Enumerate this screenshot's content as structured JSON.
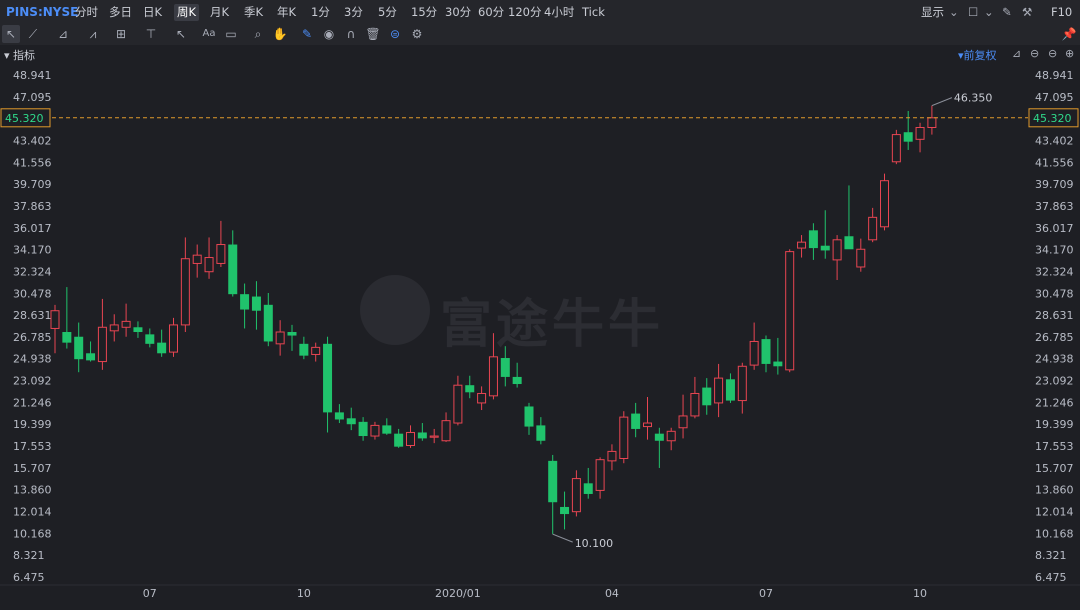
{
  "symbol": "PINS:NYSE",
  "periods": [
    "分时",
    "多日",
    "日K",
    "周K",
    "月K",
    "季K",
    "年K",
    "1分",
    "3分",
    "5分",
    "15分",
    "30分",
    "60分",
    "120分",
    "4小时",
    "Tick"
  ],
  "active_period": "周K",
  "top_right": {
    "display": "显示",
    "f10": "F10"
  },
  "indicator_label": "指标",
  "adjust_label": "前复权",
  "watermark": "富途牛牛",
  "colors": {
    "up": "#e84552",
    "down": "#20c36c",
    "background": "#1e1f24",
    "current_price_line": "#e09a2b",
    "current_price_text": "#2fd88a"
  },
  "chart_data": {
    "type": "candlestick",
    "y_ticks": [
      "48.941",
      "47.095",
      "45.320",
      "43.402",
      "41.556",
      "39.709",
      "37.863",
      "36.017",
      "34.170",
      "32.324",
      "30.478",
      "28.631",
      "26.785",
      "24.938",
      "23.092",
      "21.246",
      "19.399",
      "17.553",
      "15.707",
      "13.860",
      "12.014",
      "10.168",
      "8.321",
      "6.475"
    ],
    "ylim": [
      6.475,
      48.941
    ],
    "x_labels": [
      {
        "label": "07",
        "index": 8
      },
      {
        "label": "10",
        "index": 21
      },
      {
        "label": "2020/01",
        "index": 34
      },
      {
        "label": "04",
        "index": 47
      },
      {
        "label": "07",
        "index": 60
      },
      {
        "label": "10",
        "index": 73
      }
    ],
    "current_price": "45.320",
    "high_annotation": {
      "label": "46.350",
      "value": 46.35,
      "index": 74
    },
    "low_annotation": {
      "label": "10.100",
      "value": 10.1,
      "index": 42
    },
    "candles": [
      {
        "o": 27.5,
        "h": 29.5,
        "l": 25.4,
        "c": 29.0
      },
      {
        "o": 27.2,
        "h": 31.0,
        "l": 25.8,
        "c": 26.3
      },
      {
        "o": 26.8,
        "h": 28.0,
        "l": 23.8,
        "c": 24.9
      },
      {
        "o": 25.4,
        "h": 26.4,
        "l": 24.7,
        "c": 24.8
      },
      {
        "o": 24.7,
        "h": 30.0,
        "l": 24.0,
        "c": 27.6
      },
      {
        "o": 27.3,
        "h": 28.7,
        "l": 26.4,
        "c": 27.8
      },
      {
        "o": 27.6,
        "h": 29.6,
        "l": 26.8,
        "c": 28.1
      },
      {
        "o": 27.6,
        "h": 28.1,
        "l": 26.7,
        "c": 27.2
      },
      {
        "o": 27.0,
        "h": 27.5,
        "l": 25.9,
        "c": 26.2
      },
      {
        "o": 26.3,
        "h": 27.4,
        "l": 25.1,
        "c": 25.4
      },
      {
        "o": 25.5,
        "h": 28.4,
        "l": 25.1,
        "c": 27.8
      },
      {
        "o": 27.8,
        "h": 35.2,
        "l": 27.2,
        "c": 33.4
      },
      {
        "o": 33.0,
        "h": 34.6,
        "l": 31.8,
        "c": 33.7
      },
      {
        "o": 32.3,
        "h": 35.2,
        "l": 31.7,
        "c": 33.5
      },
      {
        "o": 33.0,
        "h": 36.6,
        "l": 32.7,
        "c": 34.6
      },
      {
        "o": 34.6,
        "h": 35.8,
        "l": 30.2,
        "c": 30.4
      },
      {
        "o": 30.4,
        "h": 31.3,
        "l": 27.5,
        "c": 29.1
      },
      {
        "o": 30.2,
        "h": 31.5,
        "l": 27.4,
        "c": 29.0
      },
      {
        "o": 29.5,
        "h": 30.5,
        "l": 26.0,
        "c": 26.4
      },
      {
        "o": 26.2,
        "h": 28.2,
        "l": 25.2,
        "c": 27.2
      },
      {
        "o": 27.2,
        "h": 27.8,
        "l": 25.6,
        "c": 26.9
      },
      {
        "o": 26.2,
        "h": 26.8,
        "l": 24.9,
        "c": 25.2
      },
      {
        "o": 25.3,
        "h": 26.3,
        "l": 24.7,
        "c": 25.9
      },
      {
        "o": 26.2,
        "h": 26.8,
        "l": 18.7,
        "c": 20.4
      },
      {
        "o": 20.4,
        "h": 21.1,
        "l": 19.5,
        "c": 19.8
      },
      {
        "o": 19.9,
        "h": 20.8,
        "l": 18.9,
        "c": 19.4
      },
      {
        "o": 19.6,
        "h": 20.0,
        "l": 18.0,
        "c": 18.4
      },
      {
        "o": 18.4,
        "h": 19.6,
        "l": 18.1,
        "c": 19.3
      },
      {
        "o": 19.3,
        "h": 19.9,
        "l": 18.5,
        "c": 18.6
      },
      {
        "o": 18.6,
        "h": 19.0,
        "l": 17.4,
        "c": 17.5
      },
      {
        "o": 17.6,
        "h": 19.3,
        "l": 17.4,
        "c": 18.7
      },
      {
        "o": 18.7,
        "h": 19.5,
        "l": 18.0,
        "c": 18.2
      },
      {
        "o": 18.3,
        "h": 19.0,
        "l": 17.8,
        "c": 18.4
      },
      {
        "o": 18.0,
        "h": 20.4,
        "l": 17.9,
        "c": 19.7
      },
      {
        "o": 19.5,
        "h": 23.5,
        "l": 19.3,
        "c": 22.7
      },
      {
        "o": 22.7,
        "h": 23.5,
        "l": 21.6,
        "c": 22.1
      },
      {
        "o": 21.2,
        "h": 22.6,
        "l": 20.6,
        "c": 22.0
      },
      {
        "o": 21.8,
        "h": 27.1,
        "l": 21.5,
        "c": 25.1
      },
      {
        "o": 25.0,
        "h": 26.0,
        "l": 22.6,
        "c": 23.4
      },
      {
        "o": 23.4,
        "h": 24.6,
        "l": 22.5,
        "c": 22.8
      },
      {
        "o": 20.9,
        "h": 21.2,
        "l": 18.5,
        "c": 19.2
      },
      {
        "o": 19.3,
        "h": 20.0,
        "l": 17.7,
        "c": 18.0
      },
      {
        "o": 16.3,
        "h": 16.8,
        "l": 10.1,
        "c": 12.8
      },
      {
        "o": 12.4,
        "h": 13.7,
        "l": 10.5,
        "c": 11.8
      },
      {
        "o": 12.0,
        "h": 15.5,
        "l": 11.6,
        "c": 14.8
      },
      {
        "o": 14.4,
        "h": 15.7,
        "l": 13.1,
        "c": 13.5
      },
      {
        "o": 13.8,
        "h": 16.6,
        "l": 13.1,
        "c": 16.4
      },
      {
        "o": 16.3,
        "h": 17.7,
        "l": 15.5,
        "c": 17.1
      },
      {
        "o": 16.5,
        "h": 20.5,
        "l": 16.1,
        "c": 20.0
      },
      {
        "o": 20.3,
        "h": 21.2,
        "l": 18.3,
        "c": 19.0
      },
      {
        "o": 19.2,
        "h": 21.7,
        "l": 18.1,
        "c": 19.5
      },
      {
        "o": 18.6,
        "h": 19.1,
        "l": 15.7,
        "c": 18.0
      },
      {
        "o": 18.0,
        "h": 19.1,
        "l": 17.2,
        "c": 18.8
      },
      {
        "o": 19.1,
        "h": 21.9,
        "l": 18.2,
        "c": 20.1
      },
      {
        "o": 20.1,
        "h": 23.4,
        "l": 19.9,
        "c": 22.0
      },
      {
        "o": 22.5,
        "h": 23.3,
        "l": 20.2,
        "c": 21.0
      },
      {
        "o": 21.2,
        "h": 24.5,
        "l": 20.0,
        "c": 23.3
      },
      {
        "o": 23.2,
        "h": 23.7,
        "l": 21.2,
        "c": 21.4
      },
      {
        "o": 21.4,
        "h": 24.6,
        "l": 20.3,
        "c": 24.3
      },
      {
        "o": 24.4,
        "h": 28.0,
        "l": 24.0,
        "c": 26.4
      },
      {
        "o": 26.6,
        "h": 26.9,
        "l": 23.8,
        "c": 24.5
      },
      {
        "o": 24.7,
        "h": 26.7,
        "l": 23.6,
        "c": 24.3
      },
      {
        "o": 24.0,
        "h": 34.2,
        "l": 23.8,
        "c": 34.0
      },
      {
        "o": 34.3,
        "h": 35.4,
        "l": 33.5,
        "c": 34.8
      },
      {
        "o": 35.8,
        "h": 36.4,
        "l": 33.3,
        "c": 34.3
      },
      {
        "o": 34.5,
        "h": 37.5,
        "l": 33.4,
        "c": 34.1
      },
      {
        "o": 33.3,
        "h": 35.4,
        "l": 31.6,
        "c": 35.0
      },
      {
        "o": 35.3,
        "h": 39.6,
        "l": 34.3,
        "c": 34.2
      },
      {
        "o": 32.7,
        "h": 35.1,
        "l": 32.3,
        "c": 34.2
      },
      {
        "o": 35.0,
        "h": 37.7,
        "l": 34.8,
        "c": 36.9
      },
      {
        "o": 36.1,
        "h": 40.6,
        "l": 35.8,
        "c": 40.0
      },
      {
        "o": 41.6,
        "h": 44.3,
        "l": 41.4,
        "c": 43.9
      },
      {
        "o": 44.1,
        "h": 45.9,
        "l": 42.6,
        "c": 43.3
      },
      {
        "o": 43.5,
        "h": 44.9,
        "l": 42.4,
        "c": 44.5
      },
      {
        "o": 44.5,
        "h": 46.35,
        "l": 43.9,
        "c": 45.32
      }
    ]
  }
}
